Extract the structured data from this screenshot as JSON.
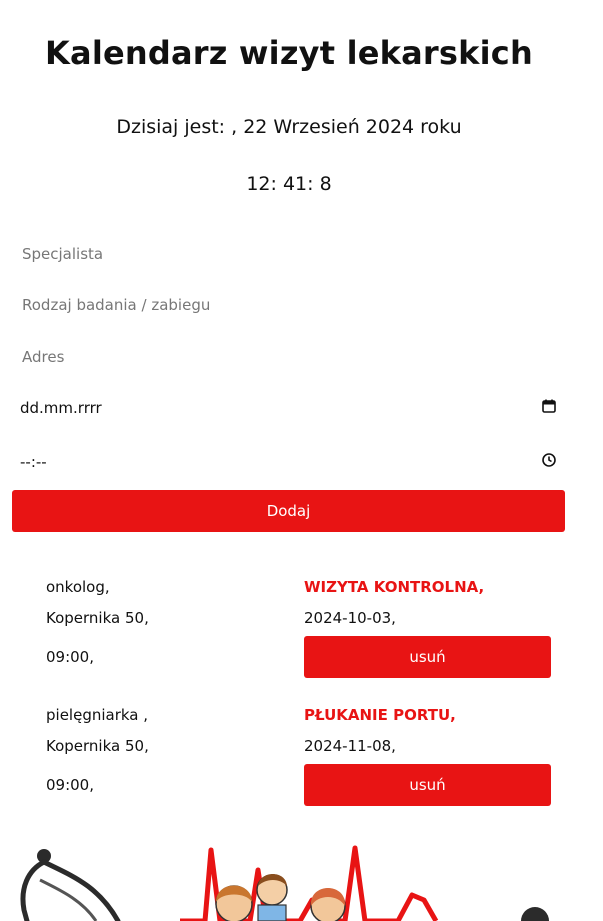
{
  "header": {
    "title": "Kalendarz wizyt lekarskich",
    "today_text": "Dzisiaj jest: , 22 Wrzesień 2024 roku",
    "clock": "12: 41: 8"
  },
  "form": {
    "specialist_placeholder": "Specjalista",
    "procedure_placeholder": "Rodzaj badania / zabiegu",
    "address_placeholder": "Adres",
    "date_value": "dd.mm.rrrr",
    "time_value": "--:--",
    "add_label": "Dodaj"
  },
  "appointments": [
    {
      "specialist": "onkolog,",
      "procedure": "WIZYTA KONTROLNA,",
      "address": "Kopernika 50,",
      "date": "2024-10-03,",
      "time": "09:00,",
      "delete_label": "usuń"
    },
    {
      "specialist": "pielęgniarka ,",
      "procedure": "PŁUKANIE PORTU,",
      "address": "Kopernika 50,",
      "date": "2024-11-08,",
      "time": "09:00,",
      "delete_label": "usuń"
    }
  ],
  "icons": {
    "date_picker": "calendar-icon",
    "time_picker": "clock-icon"
  },
  "colors": {
    "accent": "#e81414",
    "text": "#111111",
    "placeholder": "#777777"
  }
}
